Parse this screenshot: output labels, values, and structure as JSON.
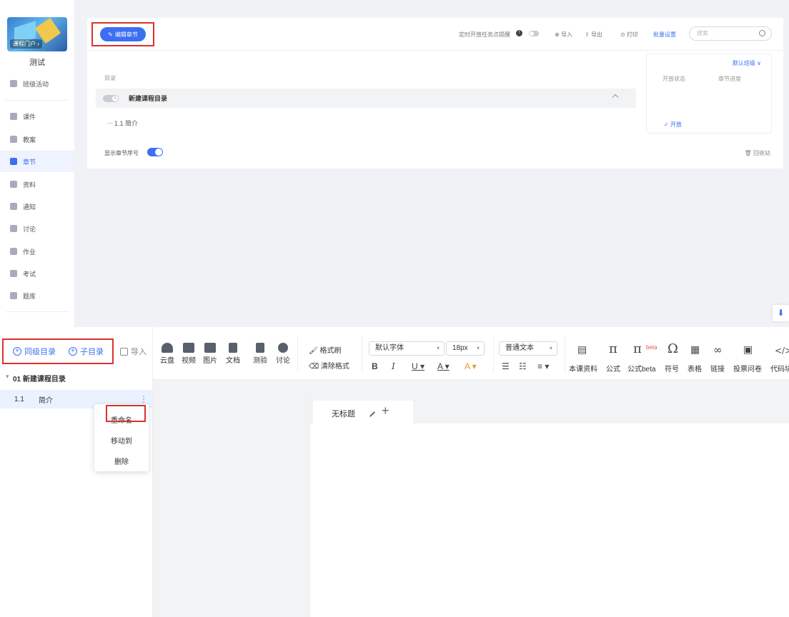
{
  "sidebar": {
    "cover_label": "课程门户 ›",
    "course_name": "测试",
    "items": [
      {
        "label": "班级活动",
        "icon": "grid-icon"
      },
      {
        "label": "课件",
        "icon": "play-file-icon"
      },
      {
        "label": "教案",
        "icon": "lesson-file-icon"
      },
      {
        "label": "章节",
        "icon": "chapter-icon",
        "active": true
      },
      {
        "label": "资料",
        "icon": "folder-icon"
      },
      {
        "label": "通知",
        "icon": "megaphone-icon"
      },
      {
        "label": "讨论",
        "icon": "chat-icon"
      },
      {
        "label": "作业",
        "icon": "homework-icon"
      },
      {
        "label": "考试",
        "icon": "exam-icon"
      },
      {
        "label": "题库",
        "icon": "question-bank-icon"
      }
    ]
  },
  "card": {
    "edit_button": "编辑章节",
    "reminder": "定时开放任务点提醒",
    "import": "导入",
    "export": "导出",
    "print": "打印",
    "batch": "批量设置",
    "search_placeholder": "搜索",
    "dir_label": "目录",
    "chapter_index": "1",
    "chapter_title": "新建课程目录",
    "section": "1.1 简介",
    "show_number": "显示章节序号",
    "recycle": "回收站",
    "class_select": "默认班级",
    "col_status": "开放状态",
    "col_progress": "章节进度",
    "open_status": "✓ 开放"
  },
  "tree": {
    "sibling_btn": "同级目录",
    "child_btn": "子目录",
    "import_btn": "导入",
    "chapter": "01  新建课程目录",
    "section_num": "1.1",
    "section_title": "简介",
    "menu": [
      "重命名",
      "移动到",
      "删除"
    ]
  },
  "toolbar": {
    "media": [
      "云盘",
      "视频",
      "图片",
      "文档",
      "测验",
      "讨论"
    ],
    "format_painter": "格式刷",
    "clear_format": "清除格式",
    "font": "默认字体",
    "size": "18px",
    "style": "普通文本",
    "insert": [
      "本课资料",
      "公式",
      "公式beta",
      "符号",
      "表格",
      "链接",
      "投票问卷",
      "代码块"
    ],
    "beta": "beta"
  },
  "doc": {
    "tab_title": "无标题"
  },
  "colors": {
    "accent": "#3c6ff2",
    "highlight": "#d9322e"
  }
}
